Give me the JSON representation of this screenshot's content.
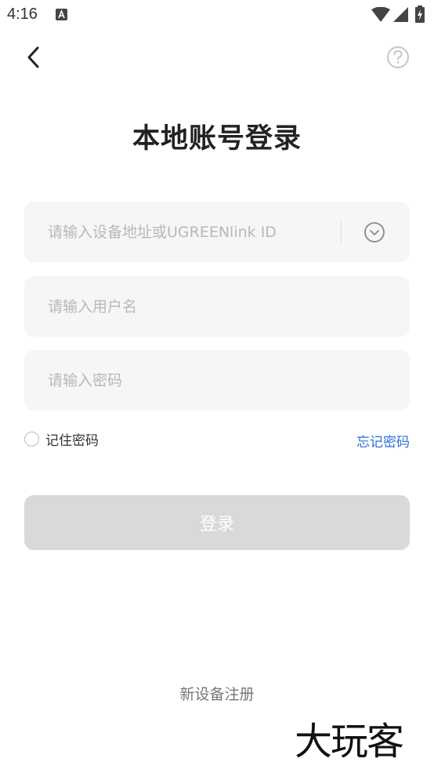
{
  "status_bar": {
    "time": "4:16",
    "notification_icon": "text-notification-icon",
    "wifi_icon": "wifi-icon",
    "signal_icon": "cellular-signal-icon",
    "battery_icon": "battery-charging-icon"
  },
  "header": {
    "back_icon": "chevron-left-icon",
    "help_icon": "question-circle-icon"
  },
  "page": {
    "title": "本地账号登录"
  },
  "form": {
    "address": {
      "placeholder": "请输入设备地址或UGREENlink ID",
      "value": "",
      "dropdown_icon": "chevron-down-circle-icon"
    },
    "username": {
      "placeholder": "请输入用户名",
      "value": ""
    },
    "password": {
      "placeholder": "请输入密码",
      "value": ""
    },
    "remember_label": "记住密码",
    "remember_checked": false,
    "forgot_label": "忘记密码",
    "login_label": "登录"
  },
  "footer": {
    "register_label": "新设备注册"
  },
  "watermark": {
    "text": "大玩客"
  },
  "colors": {
    "link": "#2f6fd6",
    "button_disabled": "#d9d9d9",
    "field_bg": "#f6f6f6"
  }
}
